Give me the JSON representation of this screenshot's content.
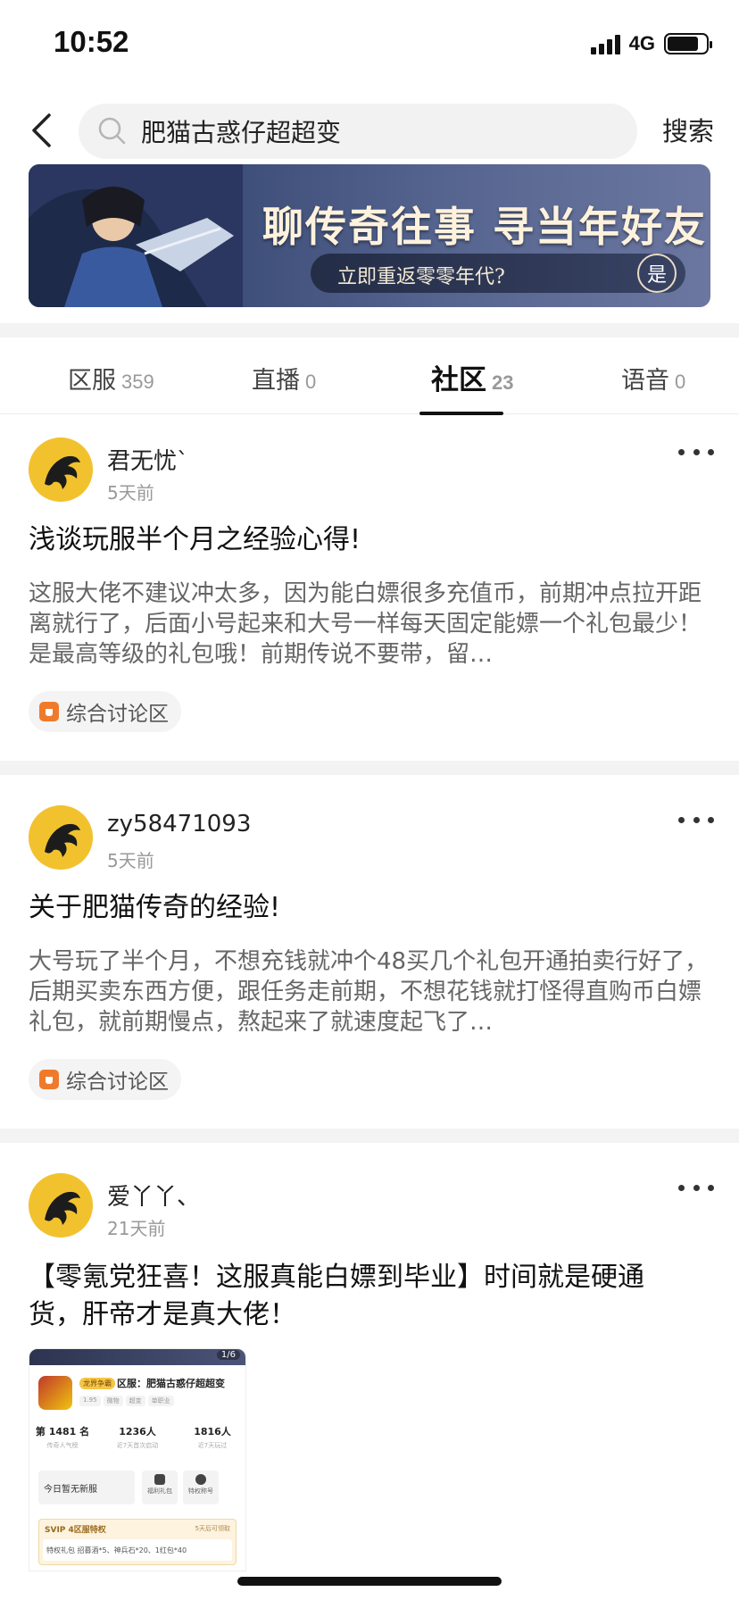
{
  "status_bar": {
    "time": "10:52",
    "network": "4G"
  },
  "header": {
    "search_value": "肥猫古惑仔超超变",
    "search_button": "搜索"
  },
  "banner": {
    "title": "聊传奇往事 寻当年好友",
    "subtitle": "立即重返零零年代?",
    "cta": "是"
  },
  "tabs": [
    {
      "label": "区服",
      "count": "359"
    },
    {
      "label": "直播",
      "count": "0"
    },
    {
      "label": "社区",
      "count": "23",
      "active": true
    },
    {
      "label": "语音",
      "count": "0"
    }
  ],
  "posts": [
    {
      "author": "君无忧`",
      "time": "5天前",
      "title": "浅谈玩服半个月之经验心得!",
      "body": "这服大佬不建议冲太多，因为能白嫖很多充值币，前期冲点拉开距离就行了，后面小号起来和大号一样每天固定能嫖一个礼包最少！是最高等级的礼包哦！前期传说不要带，留…",
      "tag": "综合讨论区"
    },
    {
      "author": "zy58471093",
      "time": "5天前",
      "title": "关于肥猫传奇的经验!",
      "body": "大号玩了半个月，不想充钱就冲个48买几个礼包开通拍卖行好了，后期买卖东西方便，跟任务走前期，不想花钱就打怪得直购币白嫖礼包，就前期慢点，熬起来了就速度起飞了…",
      "tag": "综合讨论区"
    },
    {
      "author": "爱丫丫、",
      "time": "21天前",
      "title": "【零氪党狂喜！这服真能白嫖到毕业】时间就是硬通货，肝帝才是真大佬！",
      "thumbnail": {
        "page": "1/6",
        "badge": "龙界争霸",
        "server": "区服：肥猫古惑仔超超变",
        "chips": [
          "1.95",
          "微物",
          "超变",
          "单职业"
        ],
        "stats": [
          {
            "value": "第 1481 名",
            "label": "传奇人气榜"
          },
          {
            "value": "1236人",
            "label": "近7天首次启动"
          },
          {
            "value": "1816人",
            "label": "近7天玩过"
          }
        ],
        "no_server": "今日暂无新服",
        "gifts": [
          "福利礼包",
          "特权称号"
        ],
        "svip_title": "SVIP 4区服特权",
        "svip_note": "5天后可领取",
        "svip_body": "特权礼包    招募酒*5、神兵石*20、1红包*40"
      }
    }
  ]
}
